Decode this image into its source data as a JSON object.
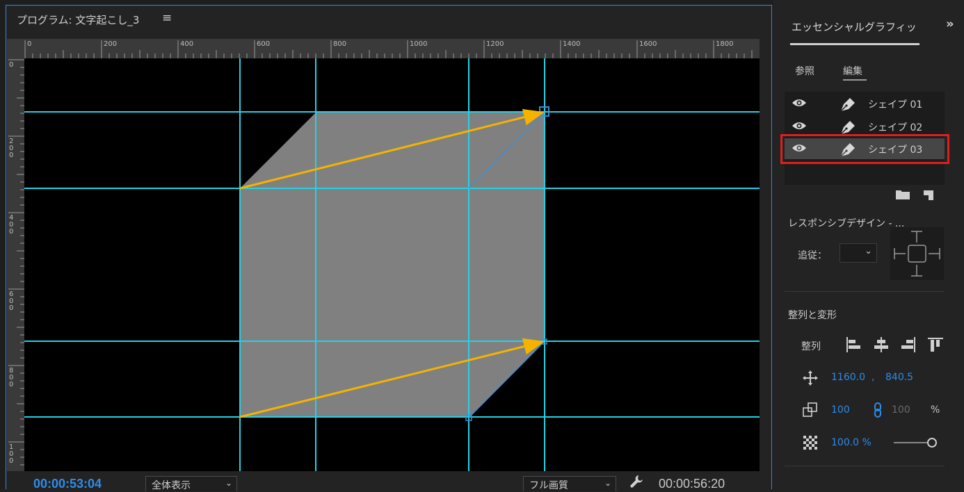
{
  "monitor": {
    "title": "プログラム: 文字起こし_3",
    "menu_icon": "hamburger-icon",
    "ruler_h_labels": [
      "0",
      "200",
      "400",
      "600",
      "800",
      "1000",
      "1200",
      "1400",
      "1600",
      "1800"
    ],
    "ruler_v_labels": [
      "0",
      "2\n0\n0",
      "4\n0\n0",
      "6\n0\n0",
      "8\n0\n0",
      "1\n0\n0"
    ],
    "timecode_current": "00:00:53:04",
    "zoom_select": "全体表示",
    "quality_select": "フル画質",
    "settings_icon": "wrench-icon",
    "timecode_duration": "00:00:56:20",
    "guide_color": "#22d3e8",
    "shape_color": "#808080",
    "arrow_color": "#f5b300"
  },
  "panel": {
    "title": "エッセンシャルグラフィッ",
    "more_icon": "double-chevron-right-icon",
    "tabs": [
      {
        "label": "参照"
      },
      {
        "label": "編集"
      }
    ],
    "layers": [
      {
        "name": "シェイプ 01"
      },
      {
        "name": "シェイプ 02"
      },
      {
        "name": "シェイプ 03"
      }
    ],
    "responsive": {
      "title": "レスポンシブデザイン - ...",
      "follow_label": "追従：",
      "follow_value": ""
    },
    "align": {
      "title": "整列と変形",
      "align_label": "整列",
      "position_x": "1160.0",
      "position_sep": ",",
      "position_y": "840.5",
      "scale": "100",
      "scale_linked": "100",
      "scale_unit": "%",
      "opacity": "100.0 %"
    },
    "accent_color": "#2d8ceb"
  }
}
